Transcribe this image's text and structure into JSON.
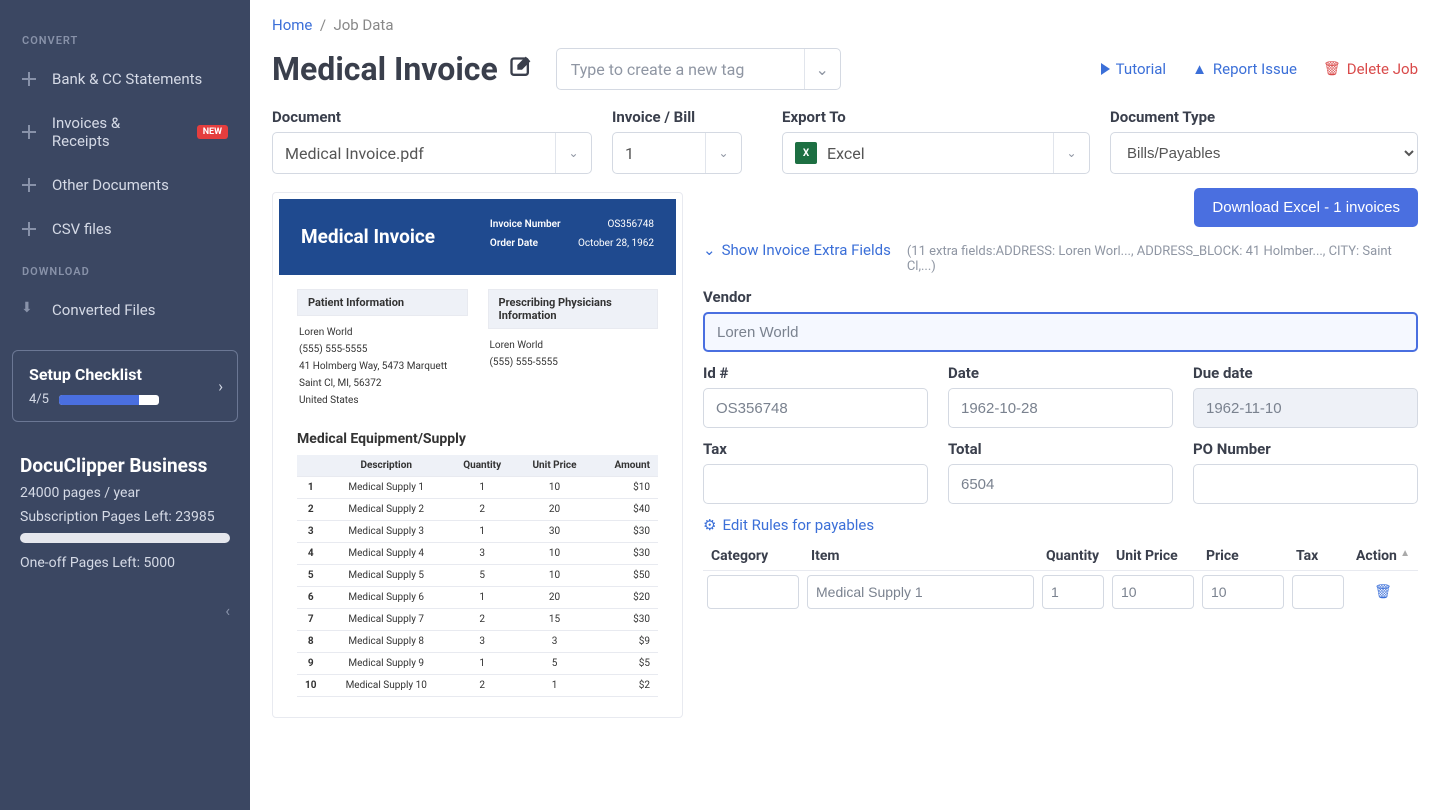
{
  "sidebar": {
    "section_convert": "CONVERT",
    "section_download": "DOWNLOAD",
    "items": {
      "bank": "Bank & CC Statements",
      "invoices": "Invoices & Receipts",
      "other": "Other Documents",
      "csv": "CSV files",
      "converted": "Converted Files"
    },
    "new_badge": "NEW",
    "checklist": {
      "title": "Setup Checklist",
      "count": "4/5"
    },
    "plan": {
      "name": "DocuClipper Business",
      "pages_year": "24000 pages / year",
      "sub_left": "Subscription Pages Left: 23985",
      "oneoff_left": "One-off Pages Left: 5000"
    }
  },
  "breadcrumbs": {
    "home": "Home",
    "current": "Job Data"
  },
  "page_title": "Medical Invoice",
  "tag_placeholder": "Type to create a new tag",
  "actions": {
    "tutorial": "Tutorial",
    "report": "Report Issue",
    "delete": "Delete Job"
  },
  "labels": {
    "document": "Document",
    "invoice_bill": "Invoice / Bill",
    "export_to": "Export To",
    "doc_type": "Document Type",
    "vendor": "Vendor",
    "id": "Id #",
    "date": "Date",
    "due": "Due date",
    "tax": "Tax",
    "total": "Total",
    "po": "PO Number"
  },
  "selects": {
    "document": "Medical Invoice.pdf",
    "invoice_bill": "1",
    "export_to": "Excel",
    "doc_type": "Bills/Payables"
  },
  "download_button": "Download Excel - 1 invoices",
  "show_extra": "Show Invoice Extra Fields",
  "extra_hint": "(11 extra fields:ADDRESS: Loren Worl..., ADDRESS_BLOCK: 41 Holmber..., CITY: Saint Cl,...)",
  "fields": {
    "vendor": "Loren World",
    "id": "OS356748",
    "date": "1962-10-28",
    "due": "1962-11-10",
    "tax": "",
    "total": "6504",
    "po": ""
  },
  "edit_rules": "Edit Rules for payables",
  "line_headers": {
    "category": "Category",
    "item": "Item",
    "quantity": "Quantity",
    "unit_price": "Unit Price",
    "price": "Price",
    "tax": "Tax",
    "action": "Action"
  },
  "line_row": {
    "category": "",
    "item": "Medical Supply 1",
    "quantity": "1",
    "unit_price": "10",
    "price": "10",
    "tax": ""
  },
  "preview": {
    "title": "Medical Invoice",
    "inv_num_label": "Invoice Number",
    "inv_num": "OS356748",
    "order_date_label": "Order Date",
    "order_date": "October 28, 1962",
    "patient_header": "Patient Information",
    "physician_header": "Prescribing Physicians Information",
    "patient": {
      "name": "Loren World",
      "phone": "(555) 555-5555",
      "addr1": "41 Holmberg Way, 5473 Marquett",
      "addr2": "Saint Cl, MI, 56372",
      "addr3": "United States"
    },
    "physician": {
      "name": "Loren World",
      "phone": "(555) 555-5555"
    },
    "supply_title": "Medical Equipment/Supply",
    "headers": {
      "desc": "Description",
      "qty": "Quantity",
      "unit": "Unit Price",
      "amount": "Amount"
    },
    "rows": [
      {
        "n": "1",
        "desc": "Medical Supply 1",
        "qty": "1",
        "unit": "10",
        "amount": "$10"
      },
      {
        "n": "2",
        "desc": "Medical Supply 2",
        "qty": "2",
        "unit": "20",
        "amount": "$40"
      },
      {
        "n": "3",
        "desc": "Medical Supply 3",
        "qty": "1",
        "unit": "30",
        "amount": "$30"
      },
      {
        "n": "4",
        "desc": "Medical Supply 4",
        "qty": "3",
        "unit": "10",
        "amount": "$30"
      },
      {
        "n": "5",
        "desc": "Medical Supply 5",
        "qty": "5",
        "unit": "10",
        "amount": "$50"
      },
      {
        "n": "6",
        "desc": "Medical Supply 6",
        "qty": "1",
        "unit": "20",
        "amount": "$20"
      },
      {
        "n": "7",
        "desc": "Medical Supply 7",
        "qty": "2",
        "unit": "15",
        "amount": "$30"
      },
      {
        "n": "8",
        "desc": "Medical Supply 8",
        "qty": "3",
        "unit": "3",
        "amount": "$9"
      },
      {
        "n": "9",
        "desc": "Medical Supply 9",
        "qty": "1",
        "unit": "5",
        "amount": "$5"
      },
      {
        "n": "10",
        "desc": "Medical Supply 10",
        "qty": "2",
        "unit": "1",
        "amount": "$2"
      }
    ]
  }
}
